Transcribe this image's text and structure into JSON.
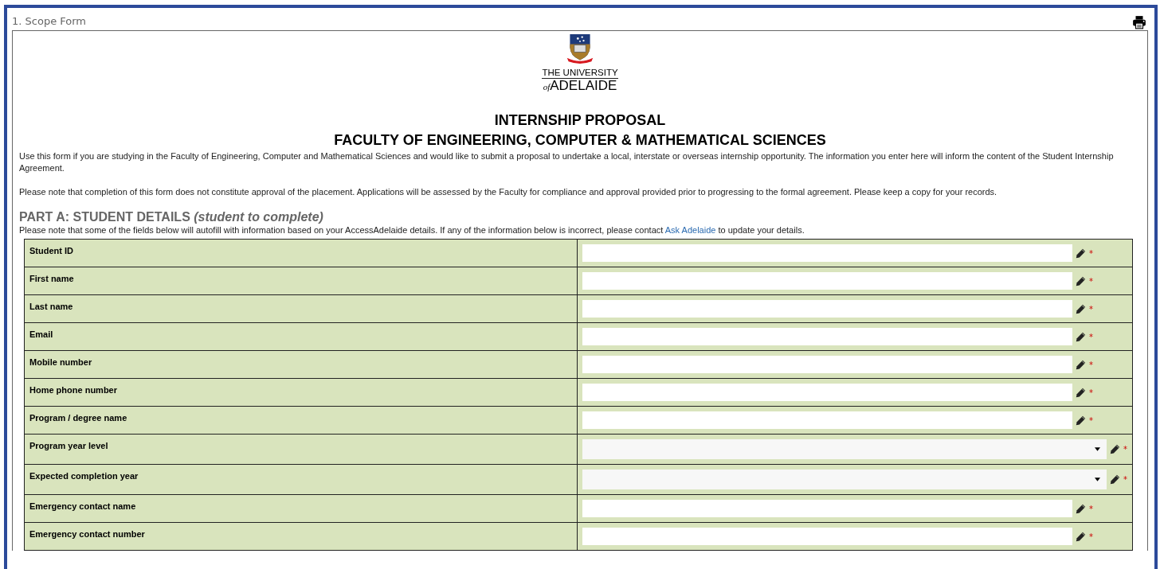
{
  "panel": {
    "title": "1. Scope Form"
  },
  "logo": {
    "line1": "THE UNIVERSITY",
    "line2_prefix": "of",
    "line2": "ADELAIDE"
  },
  "headings": [
    "INTERNSHIP PROPOSAL",
    "FACULTY OF ENGINEERING, COMPUTER & MATHEMATICAL SCIENCES"
  ],
  "paragraphs": [
    "Use this form if you are studying in the Faculty of Engineering, Computer and Mathematical Sciences and would like to submit a proposal to undertake a local, interstate or overseas internship opportunity. The information you enter here will inform the content of the Student Internship Agreement.",
    "Please note that completion of this form does not constitute approval of the placement. Applications will be assessed by the Faculty for compliance and approval provided prior to progressing to the formal agreement. Please keep a copy for your records."
  ],
  "section": {
    "title": "PART A: STUDENT DETAILS ",
    "subtitle": "(student to complete)",
    "note_before": "Please note that some of the fields below will autofill with information based on your AccessAdelaide details. If any of the information below is incorrect, please contact ",
    "link": "Ask Adelaide",
    "note_after": " to update your details."
  },
  "fields": [
    {
      "label": "Student ID",
      "kind": "text",
      "required_mark": "*"
    },
    {
      "label": "First name",
      "kind": "text",
      "required_mark": "*"
    },
    {
      "label": "Last name",
      "kind": "text",
      "required_mark": "*"
    },
    {
      "label": "Email",
      "kind": "text",
      "required_mark": "*"
    },
    {
      "label": "Mobile number",
      "kind": "text",
      "required_mark": "*"
    },
    {
      "label": "Home phone number",
      "kind": "text",
      "required_mark": "*"
    },
    {
      "label": "Program / degree name",
      "kind": "text",
      "required_mark": "*"
    },
    {
      "label": "Program year level",
      "kind": "select",
      "required_mark": "*"
    },
    {
      "label": "Expected completion year",
      "kind": "select",
      "required_mark": "*"
    },
    {
      "label": "Emergency contact name",
      "kind": "text",
      "required_mark": "*"
    },
    {
      "label": "Emergency contact number",
      "kind": "text",
      "required_mark": "*"
    }
  ]
}
